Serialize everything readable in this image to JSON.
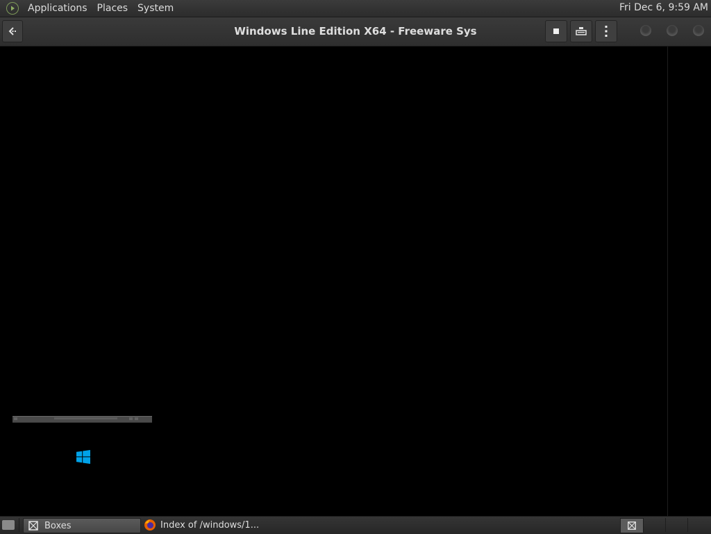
{
  "top_panel": {
    "menus": [
      "Applications",
      "Places",
      "System"
    ],
    "clock": "Fri Dec  6,  9:59 AM",
    "logo_icon": "menu-logo-icon"
  },
  "header": {
    "title": "Windows Line Edition X64 - Freeware Sys",
    "back_icon": "back-arrow-icon",
    "buttons": [
      "stop-icon",
      "keyboard-icon",
      "kebab-menu-icon"
    ],
    "window_controls": [
      "minimize",
      "maximize",
      "close"
    ]
  },
  "vm_screen": {
    "logo_color": "#00a2e8",
    "logo_icon": "windows-logo-icon"
  },
  "taskbar": {
    "tasks": [
      {
        "label": "Boxes",
        "icon": "boxes-icon",
        "active": true
      },
      {
        "label": "Index of /windows/1...",
        "icon": "firefox-icon",
        "active": false
      }
    ]
  }
}
